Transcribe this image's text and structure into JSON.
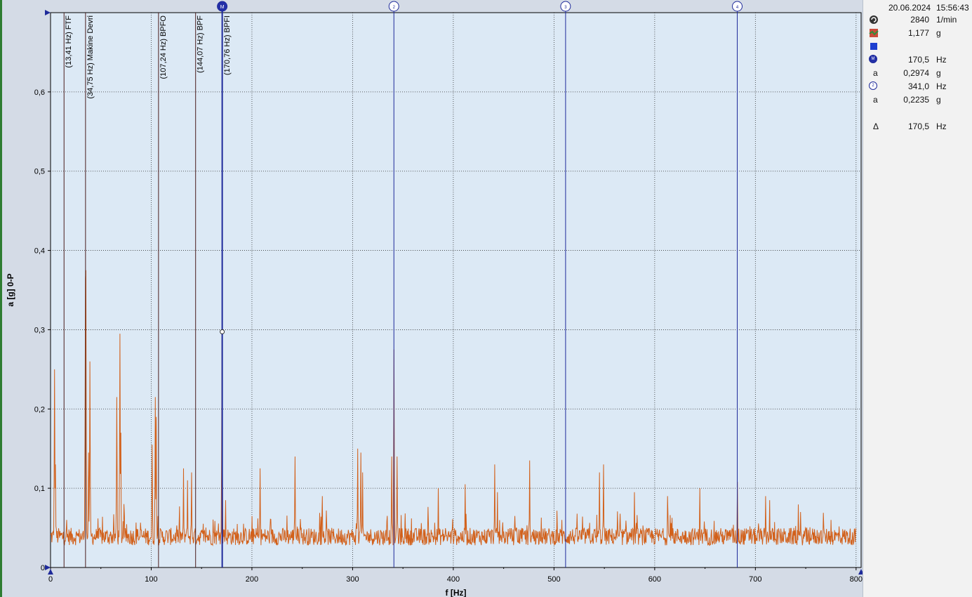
{
  "chart_data": {
    "type": "line",
    "xlabel": "f [Hz]",
    "ylabel": "a [g] 0-P",
    "xlim": [
      0,
      805
    ],
    "ylim": [
      0,
      0.7
    ],
    "xticks": [
      0,
      100,
      200,
      300,
      400,
      500,
      600,
      700,
      800
    ],
    "yticks": [
      0,
      0.1,
      0.2,
      0.3,
      0.4,
      0.5,
      0.6
    ],
    "ytick_labels": [
      "0",
      "0,1",
      "0,2",
      "0,3",
      "0,4",
      "0,5",
      "0,6"
    ],
    "grid": true,
    "colors": {
      "series": "#d2601a",
      "cursor": "#1e2a9a",
      "fault_line": "#4a1c1c",
      "plot_bg": "#dce9f5"
    },
    "fault_frequencies": [
      {
        "freq": 13.41,
        "label": "(13,41 Hz) FTF"
      },
      {
        "freq": 34.75,
        "label": "(34,75 Hz) Makine Devri"
      },
      {
        "freq": 107.24,
        "label": "(107,24 Hz) BPFO"
      },
      {
        "freq": 144.07,
        "label": "(144,07 Hz) BPF"
      },
      {
        "freq": 170.76,
        "label": "(170,76 Hz) BPFI"
      }
    ],
    "cursors": [
      {
        "label": "M",
        "freq": 170.5,
        "amp": 0.2974
      },
      {
        "label": "2",
        "freq": 341.0
      },
      {
        "label": "3",
        "freq": 511.5
      },
      {
        "label": "4",
        "freq": 682.0
      }
    ],
    "peaks": [
      {
        "f": 4,
        "a": 0.25
      },
      {
        "f": 5,
        "a": 0.13
      },
      {
        "f": 34.5,
        "a": 0.365
      },
      {
        "f": 35,
        "a": 0.375
      },
      {
        "f": 38,
        "a": 0.145
      },
      {
        "f": 39,
        "a": 0.26
      },
      {
        "f": 66,
        "a": 0.215
      },
      {
        "f": 69,
        "a": 0.295
      },
      {
        "f": 70,
        "a": 0.17
      },
      {
        "f": 73,
        "a": 0.08
      },
      {
        "f": 101,
        "a": 0.155
      },
      {
        "f": 104,
        "a": 0.215
      },
      {
        "f": 105,
        "a": 0.19
      },
      {
        "f": 132,
        "a": 0.125
      },
      {
        "f": 136,
        "a": 0.11
      },
      {
        "f": 140,
        "a": 0.12
      },
      {
        "f": 170.5,
        "a": 0.297
      },
      {
        "f": 174,
        "a": 0.085
      },
      {
        "f": 208,
        "a": 0.125
      },
      {
        "f": 243,
        "a": 0.14
      },
      {
        "f": 270,
        "a": 0.09
      },
      {
        "f": 305,
        "a": 0.15
      },
      {
        "f": 308,
        "a": 0.145
      },
      {
        "f": 310,
        "a": 0.12
      },
      {
        "f": 339,
        "a": 0.14
      },
      {
        "f": 341,
        "a": 0.275
      },
      {
        "f": 344,
        "a": 0.14
      },
      {
        "f": 385,
        "a": 0.1
      },
      {
        "f": 412,
        "a": 0.105
      },
      {
        "f": 441,
        "a": 0.13
      },
      {
        "f": 444,
        "a": 0.095
      },
      {
        "f": 476,
        "a": 0.135
      },
      {
        "f": 508,
        "a": 0.06
      },
      {
        "f": 545,
        "a": 0.12
      },
      {
        "f": 549,
        "a": 0.13
      },
      {
        "f": 580,
        "a": 0.095
      },
      {
        "f": 613,
        "a": 0.09
      },
      {
        "f": 645,
        "a": 0.1
      },
      {
        "f": 682,
        "a": 0.108
      },
      {
        "f": 710,
        "a": 0.09
      },
      {
        "f": 714,
        "a": 0.085
      },
      {
        "f": 745,
        "a": 0.07
      },
      {
        "f": 775,
        "a": 0.06
      }
    ]
  },
  "side_panel": {
    "date": "20.06.2024",
    "time": "15:56:43",
    "rows": [
      {
        "icon": "rpm-icon",
        "value": "2840",
        "unit": "1/min"
      },
      {
        "icon": "overall-icon",
        "value": "1,177",
        "unit": "g"
      },
      {
        "icon": "blue-square-icon",
        "value": "",
        "unit": ""
      },
      {
        "icon": "marker-m-icon",
        "value": "170,5",
        "unit": "Hz"
      },
      {
        "icon": "a",
        "value": "0,2974",
        "unit": "g"
      },
      {
        "icon": "marker-2-icon",
        "value": "341,0",
        "unit": "Hz"
      },
      {
        "icon": "a",
        "value": "0,2235",
        "unit": "g"
      },
      {
        "icon": "",
        "value": "",
        "unit": ""
      },
      {
        "icon": "Δ",
        "value": "170,5",
        "unit": "Hz"
      }
    ]
  }
}
